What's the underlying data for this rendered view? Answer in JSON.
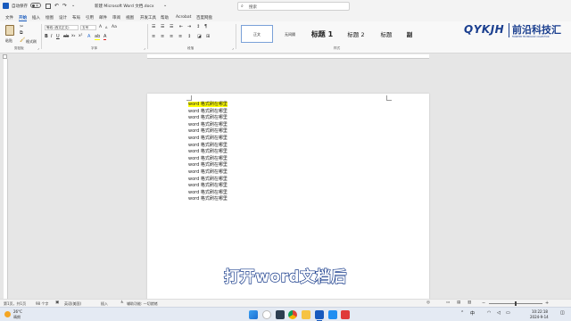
{
  "titlebar": {
    "autosave_label": "自动保存",
    "autosave_state": "关",
    "doc_title": "新建 Microsoft Word 文档.docx",
    "search_placeholder": "搜索"
  },
  "menubar": {
    "items": [
      "文件",
      "开始",
      "插入",
      "绘图",
      "设计",
      "布局",
      "引用",
      "邮件",
      "审阅",
      "视图",
      "开发工具",
      "帮助",
      "Acrobat",
      "百度网盘"
    ],
    "active_index": 1
  },
  "ribbon": {
    "paste_label": "粘贴",
    "format_painter_label": "格式刷",
    "font_name": "等线 (西文正文)",
    "font_size": "五号",
    "groups": [
      "剪贴板",
      "字体",
      "段落",
      "样式"
    ],
    "styles": [
      "正文",
      "无间隔",
      "标题 1",
      "标题 2",
      "标题",
      "副"
    ]
  },
  "watermark": {
    "logo": "QYKJH",
    "cn_name": "前沿科技汇",
    "en_name": "FRONTIER TECHNOLOGY COLLECTION"
  },
  "document": {
    "lines": [
      "word 格式刷在哪里",
      "word 格式刷在哪里",
      "word 格式刷在哪里",
      "word 格式刷在哪里",
      "word 格式刷在哪里",
      "word 格式刷在哪里",
      "word 格式刷在哪里",
      "word 格式刷在哪里",
      "word 格式刷在哪里",
      "word 格式刷在哪里",
      "word 格式刷在哪里",
      "word 格式刷在哪里",
      "word 格式刷在哪里",
      "word 格式刷在哪里",
      "word 格式刷在哪里"
    ],
    "highlighted_line": 0,
    "highlight_color": "#ffff00"
  },
  "subtitle": "打开word文档后",
  "statusbar": {
    "page": "第1页，共1页",
    "words": "98 个字",
    "language": "英语(美国)",
    "insert_mode": "插入",
    "accessibility": "辅助功能: 一切就绪"
  },
  "taskbar": {
    "weather_temp": "26°C",
    "weather_text": "晴朗",
    "time": "10:22:18",
    "date": "2024-9-14"
  },
  "colors": {
    "accent": "#185abd",
    "subtitle_fill": "#ffffff",
    "subtitle_stroke": "#1a3d8c"
  }
}
